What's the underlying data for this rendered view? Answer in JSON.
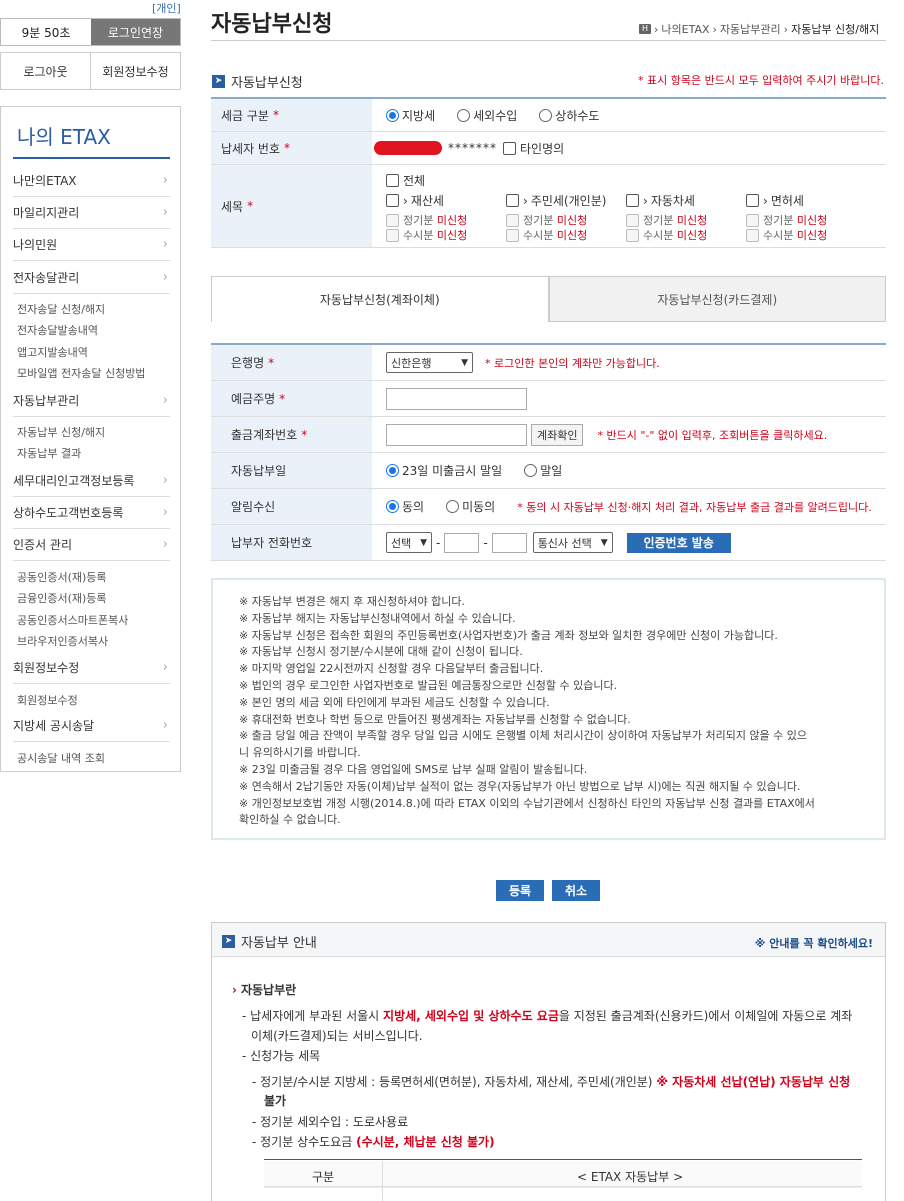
{
  "sidebar": {
    "tag": "[개인]",
    "timer": "9분 50초",
    "extend": "로그인연장",
    "logout": "로그아웃",
    "edit_profile": "회원정보수정",
    "title": "나의 ETAX",
    "items": [
      {
        "label": "나만의ETAX"
      },
      {
        "label": "마일리지관리"
      },
      {
        "label": "나의민원"
      },
      {
        "label": "전자송달관리",
        "subs": [
          "전자송달 신청/해지",
          "전자송달발송내역",
          "앱고지발송내역",
          "모바일앱 전자송달 신청방법"
        ]
      },
      {
        "label": "자동납부관리",
        "subs": [
          "자동납부 신청/해지",
          "자동납부 결과"
        ]
      },
      {
        "label": "세무대리인고객정보등록"
      },
      {
        "label": "상하수도고객번호등록"
      },
      {
        "label": "인증서 관리",
        "subs": [
          "공동인증서(재)등록",
          "금융인증서(재)등록",
          "공동인증서스마트폰복사",
          "브라우저인증서복사"
        ]
      },
      {
        "label": "회원정보수정",
        "subs": [
          "회원정보수정"
        ]
      },
      {
        "label": "지방세 공시송달",
        "subs": [
          "공시송달 내역 조회"
        ]
      }
    ]
  },
  "header": {
    "title": "자동납부신청",
    "breadcrumb": [
      "나의ETAX",
      "자동납부관리",
      "자동납부 신청/해지"
    ],
    "home_icon": "H"
  },
  "section": {
    "title": "자동납부신청",
    "required_note": "* 표시 항목은 반드시 모두 입력하여 주시기 바랍니다."
  },
  "tax_form": {
    "tax_type_label": "세금 구분",
    "tax_types": [
      "지방세",
      "세외수입",
      "상하수도"
    ],
    "taxpayer_no_label": "납세자 번호",
    "taxpayer_no_masked": "*******",
    "other_name": "타인명의",
    "item_label": "세목",
    "all": "전체",
    "items": [
      "재산세",
      "주민세(개인분)",
      "자동차세",
      "면허세"
    ],
    "regular": "정기분",
    "occasional": "수시분",
    "not_applied": "미신청"
  },
  "tabs": [
    "자동납부신청(계좌이체)",
    "자동납부신청(카드결제)"
  ],
  "account_form": {
    "bank_label": "은행명",
    "bank_value": "신한은행",
    "bank_note": "* 로그인한 본인의 계좌만 가능합니다.",
    "holder_label": "예금주명",
    "account_label": "출금계좌번호",
    "verify_btn": "계좌확인",
    "account_note": "* 반드시 \"-\" 없이 입력후, 조회버튼을 클릭하세요.",
    "pay_day_label": "자동납부일",
    "pay_days": [
      "23일 미출금시 말일",
      "말일"
    ],
    "alert_label": "알림수신",
    "alert_opts": [
      "동의",
      "미동의"
    ],
    "alert_note": "* 동의 시 자동납부 신청·해지 처리 결과, 자동납부 출금 결과를 알려드립니다.",
    "phone_label": "납부자 전화번호",
    "phone_select": "선택",
    "carrier_select": "통신사 선택",
    "cert_btn": "인증번호 발송",
    "dash": "-"
  },
  "notices": [
    {
      "text": "※ 자동납부 변경은 해지 후 재신청하셔야 합니다.",
      "red": false
    },
    {
      "text": "※ 자동납부 해지는 자동납부신청내역에서 하실 수 있습니다.",
      "red": false
    },
    {
      "text": "※ 자동납부 신청은 접속한 회원의 주민등록번호(사업자번호)가 출금 계좌 정보와 일치한 경우에만 신청이 가능합니다.",
      "red": false
    },
    {
      "text": "※ 자동납부 신청시 정기분/수시분에 대해 같이 신청이 됩니다.",
      "red": false
    },
    {
      "text": "※ 마지막 영업일 22시전까지 신청할 경우 다음달부터 출금됩니다.",
      "red": true
    },
    {
      "text": "※ 법인의 경우 로그인한 사업자번호로 발급된 예금통장으로만 신청할 수 있습니다.",
      "red": false
    },
    {
      "text": "※ 본인 명의 세금 외에 타인에게 부과된 세금도 신청할 수 있습니다.",
      "red": false
    },
    {
      "text": "※ 휴대전화 번호나 학번 등으로 만들어진 평생계좌는 자동납부를 신청할 수 없습니다.",
      "red": false
    },
    {
      "text": "※ 출금 당일 예금 잔액이 부족할 경우 당일 입금 시에도 은행별 이체 처리시간이 상이하여 자동납부가 처리되지 않을 수 있으",
      "red": true
    },
    {
      "text": "니 유의하시기를 바랍니다.",
      "red": true
    },
    {
      "text": "※ 23일 미출금될 경우 다음 영업일에 SMS로 납부 실패 알림이 발송됩니다.",
      "red": false
    },
    {
      "text": "※ 연속해서 2납기동안 자동(이체)납부 실적이 없는 경우(자동납부가 아닌 방법으로 납부 시)에는 직권 해지될 수 있습니다.",
      "red": false
    },
    {
      "text": "※ 개인정보보호법 개정 시행(2014.8.)에 따라 ETAX 이외의 수납기관에서 신청하신 타인의 자동납부 신청 결과를 ETAX에서",
      "red": false
    },
    {
      "text": "확인하실 수 없습니다.",
      "red": false
    }
  ],
  "actions": {
    "submit": "등록",
    "cancel": "취소"
  },
  "guide": {
    "title": "자동납부 안내",
    "check_note": "※ 안내를 꼭 확인하세요!",
    "heading": "자동납부란",
    "desc_1a": "- 납세자에게 부과된 서울시 ",
    "desc_1b": "지방세, 세외수입 및 상하수도 요금",
    "desc_1c": "을 지정된 출금계좌(신용카드)에서 이체일에 자동으로 계좌",
    "desc_2": "이체(카드결제)되는 서비스입니다.",
    "items_label": "- 신청가능 세목",
    "item_1a": "- 정기분/수시분 지방세 : 등록면허세(면허분), 자동차세, 재산세, 주민세(개인분) ",
    "item_1b": "※ 자동차세 선납(연납) 자동납부 신청",
    "item_1c": "불가",
    "item_2": "- 정기분 세외수입 : 도로사용료",
    "item_3a": "- 정기분 상수도요금 ",
    "item_3b": "(수시분, 체납분 신청 불가)",
    "table_col1": "구분",
    "table_col2": "< ETAX 자동납부 >"
  },
  "colors": {
    "accent": "#2a5ea0",
    "button": "#2b6cb7",
    "required": "#d0021b",
    "label_bg": "#eaf1f8"
  }
}
